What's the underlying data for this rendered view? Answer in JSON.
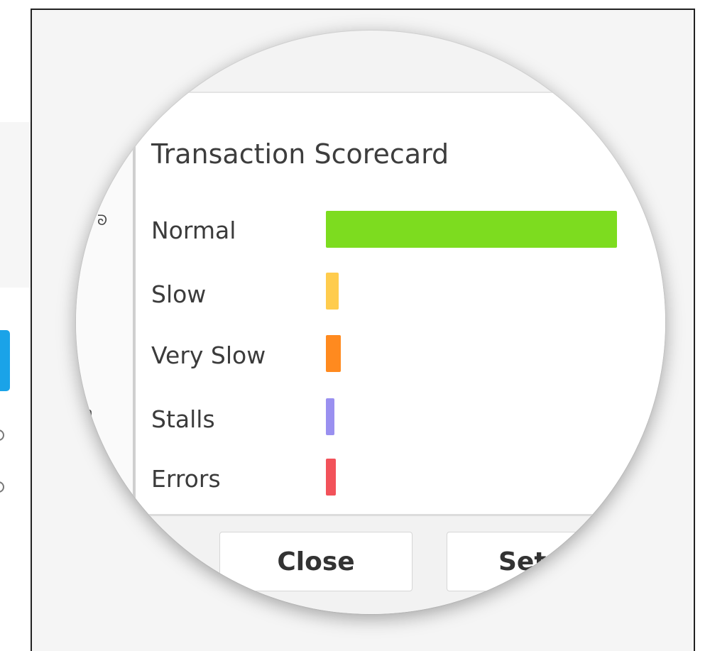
{
  "scorecard": {
    "title": "Transaction Scorecard",
    "rows": [
      {
        "label": "Normal",
        "value": 1.0,
        "color": "#7ddc1f"
      },
      {
        "label": "Slow",
        "value": 0.045,
        "color": "#ffcc4d"
      },
      {
        "label": "Very Slow",
        "value": 0.05,
        "color": "#ff8a1f"
      },
      {
        "label": "Stalls",
        "value": 0.03,
        "color": "#9a90f0"
      },
      {
        "label": "Errors",
        "value": 0.035,
        "color": "#f2525a"
      }
    ]
  },
  "buttons": {
    "close": "Close",
    "set": "Set"
  }
}
